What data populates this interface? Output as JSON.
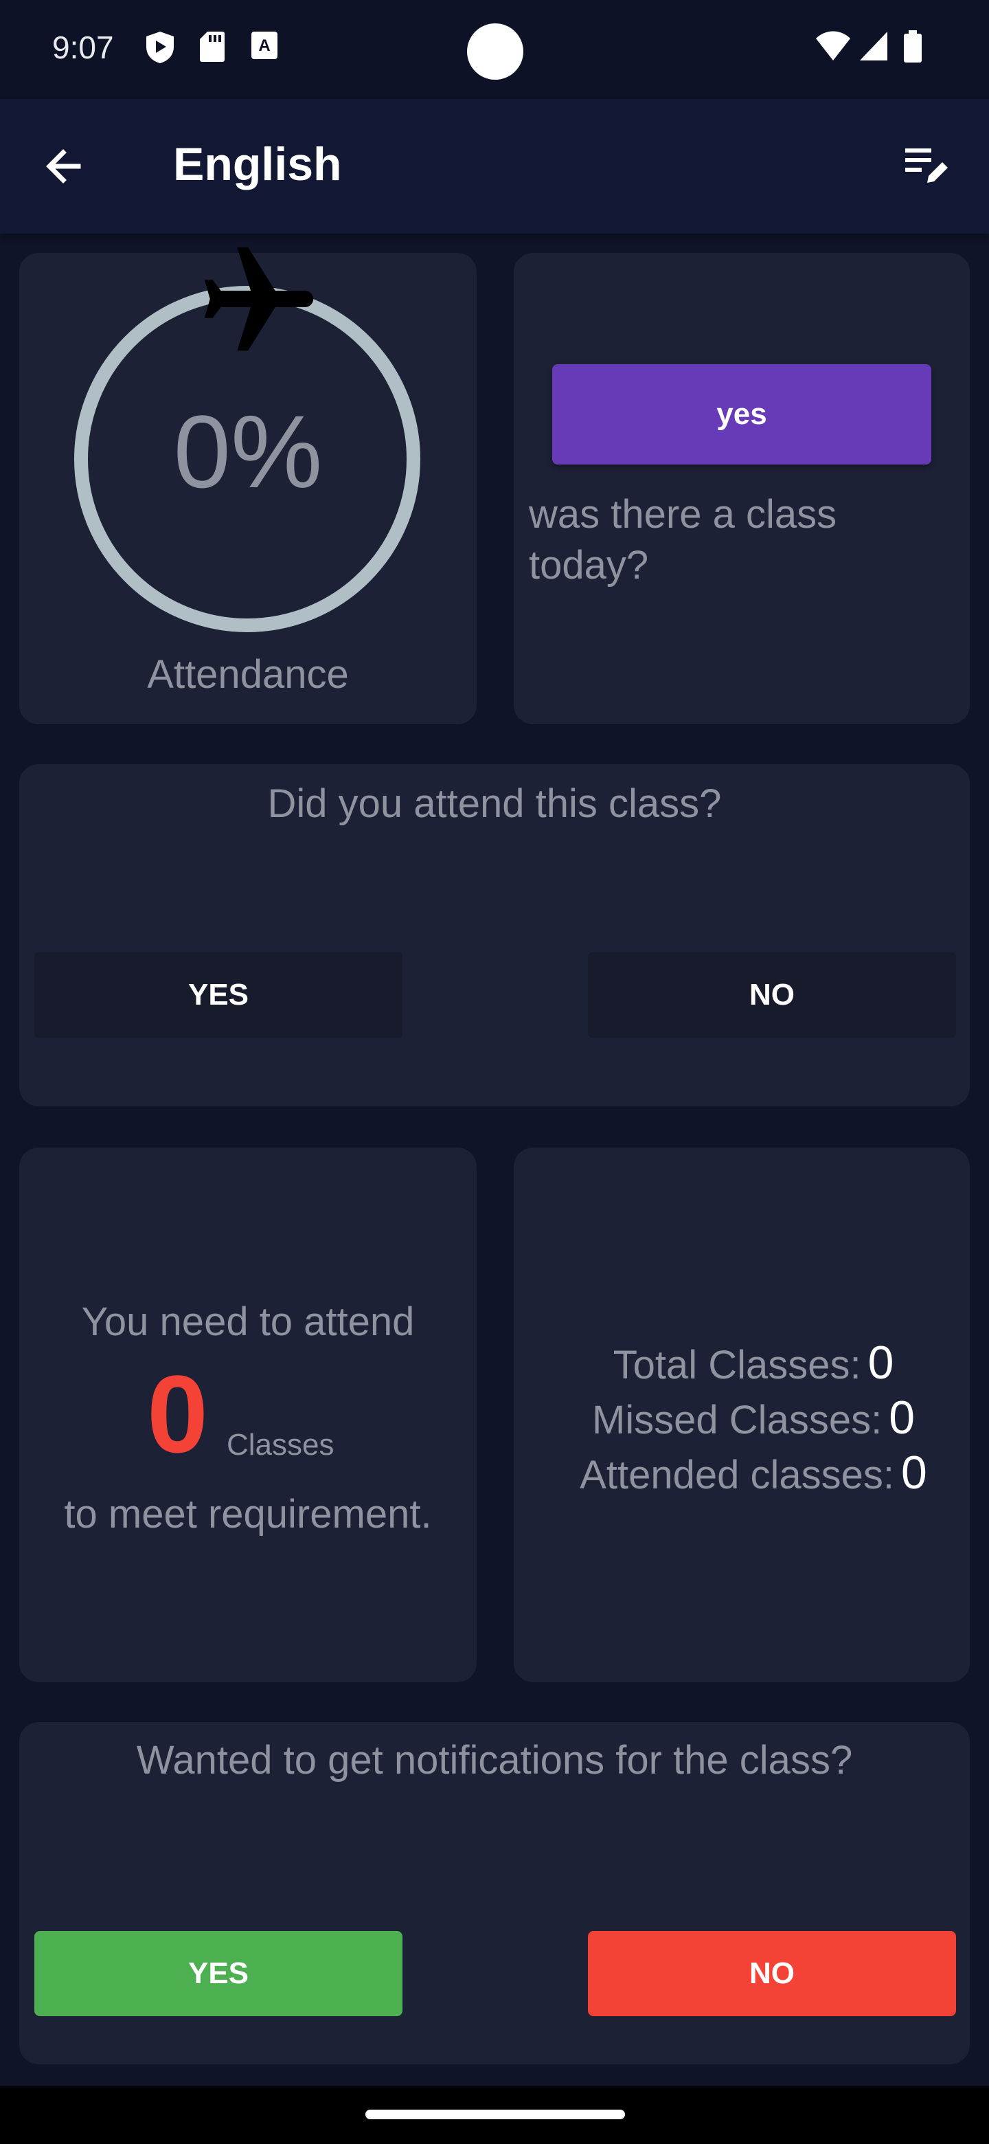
{
  "status_bar": {
    "time": "9:07",
    "icons_left": [
      "shield-play-icon",
      "sd-card-icon",
      "keyboard-a-icon"
    ],
    "icons_right": [
      "wifi-icon",
      "cell-signal-icon",
      "battery-icon"
    ]
  },
  "app_bar": {
    "title": "English",
    "back_icon": "arrow-left-icon",
    "action_icon": "edit-list-icon"
  },
  "attendance_card": {
    "percentage": "0%",
    "label": "Attendance",
    "progress": 0,
    "ring_color": "#b0bec5"
  },
  "class_today_card": {
    "button_label": "yes",
    "question": "was there a class today?",
    "button_color": "#673ab7"
  },
  "attend_card": {
    "question": "Did you attend this class?",
    "yes_label": "YES",
    "no_label": "NO"
  },
  "requirement_card": {
    "line1": "You need to attend",
    "count": "0",
    "count_unit": "Classes",
    "line2": "to meet requirement.",
    "count_color": "#f44336"
  },
  "stats_card": {
    "total_label": "Total Classes:",
    "total_value": "0",
    "missed_label": "Missed Classes:",
    "missed_value": "0",
    "attended_label": "Attended classes:",
    "attended_value": "0"
  },
  "notification_card": {
    "question": "Wanted to get notifications for the class?",
    "yes_label": "YES",
    "no_label": "NO",
    "yes_color": "#4caf50",
    "no_color": "#f44336"
  },
  "colors": {
    "background": "#0f1428",
    "card": "#1d2135",
    "app_bar": "#121733"
  }
}
